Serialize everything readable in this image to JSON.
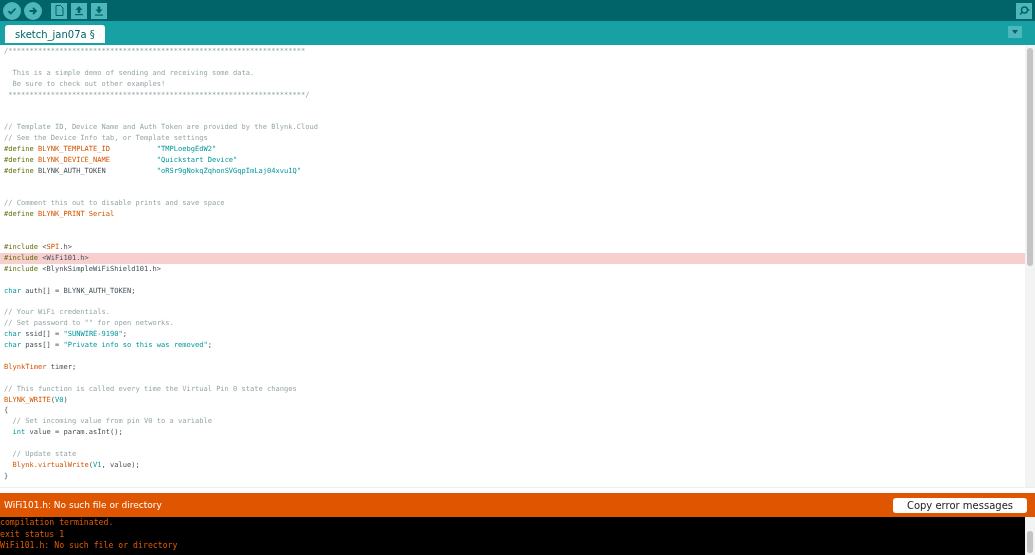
{
  "toolbar": {
    "buttons": [
      {
        "kind": "verify"
      },
      {
        "kind": "upload"
      },
      {
        "kind": "new"
      },
      {
        "kind": "open"
      },
      {
        "kind": "save"
      }
    ],
    "right_button": {
      "kind": "serial"
    }
  },
  "tabs": [
    {
      "label": "sketch_jan07a §",
      "selected": true
    }
  ],
  "editor": {
    "lines": [
      {
        "highlighted": false,
        "tokens": [
          {
            "kind": "comment",
            "text": "/**********************************************************************"
          }
        ]
      },
      {
        "highlighted": false
      },
      {
        "highlighted": false,
        "tokens": [
          {
            "kind": "comment",
            "text": "  This is a simple demo of sending and receiving some data."
          }
        ]
      },
      {
        "highlighted": false,
        "tokens": [
          {
            "kind": "comment",
            "text": "  Be sure to check out other examples!"
          }
        ]
      },
      {
        "highlighted": false,
        "tokens": [
          {
            "kind": "comment",
            "text": " **********************************************************************/"
          }
        ]
      },
      {
        "highlighted": false
      },
      {
        "highlighted": false
      },
      {
        "highlighted": false,
        "tokens": [
          {
            "kind": "comment",
            "text": "// Template ID, Device Name and Auth Token are provided by the Blynk.Cloud"
          }
        ]
      },
      {
        "highlighted": false,
        "tokens": [
          {
            "kind": "comment",
            "text": "// See the Device Info tab, or Template settings"
          }
        ]
      },
      {
        "highlighted": false,
        "tokens": [
          {
            "kind": "directive",
            "text": "#define "
          },
          {
            "kind": "constant",
            "text": "BLYNK_TEMPLATE_ID           "
          },
          {
            "kind": "string",
            "text": "\"TMPLoebgEdW2\""
          }
        ]
      },
      {
        "highlighted": false,
        "tokens": [
          {
            "kind": "directive",
            "text": "#define "
          },
          {
            "kind": "constant",
            "text": "BLYNK_DEVICE_NAME           "
          },
          {
            "kind": "string",
            "text": "\"Quickstart Device\""
          }
        ]
      },
      {
        "highlighted": false,
        "tokens": [
          {
            "kind": "directive",
            "text": "#define "
          },
          {
            "kind": "plain",
            "text": "BLYNK_AUTH_TOKEN            "
          },
          {
            "kind": "string",
            "text": "\"oRSr9gNokqZqhonSVGqpImLaj04xvu1Q\""
          }
        ]
      },
      {
        "highlighted": false
      },
      {
        "highlighted": false
      },
      {
        "highlighted": false,
        "tokens": [
          {
            "kind": "comment",
            "text": "// Comment this out to disable prints and save space"
          }
        ]
      },
      {
        "highlighted": false,
        "tokens": [
          {
            "kind": "directive",
            "text": "#define "
          },
          {
            "kind": "constant",
            "text": "BLYNK_PRINT Serial"
          }
        ]
      },
      {
        "highlighted": false
      },
      {
        "highlighted": false
      },
      {
        "highlighted": false,
        "tokens": [
          {
            "kind": "directive",
            "text": "#include "
          },
          {
            "kind": "plain",
            "text": "<"
          },
          {
            "kind": "constant",
            "text": "SPI"
          },
          {
            "kind": "plain",
            "text": ".h>"
          }
        ]
      },
      {
        "highlighted": true,
        "tokens": [
          {
            "kind": "directive",
            "text": "#include "
          },
          {
            "kind": "plain",
            "text": "<WiFi101.h>"
          }
        ]
      },
      {
        "highlighted": false,
        "tokens": [
          {
            "kind": "directive",
            "text": "#include "
          },
          {
            "kind": "plain",
            "text": "<BlynkSimpleWiFiShield101.h>"
          }
        ]
      },
      {
        "highlighted": false
      },
      {
        "highlighted": false,
        "tokens": [
          {
            "kind": "type",
            "text": "char"
          },
          {
            "kind": "plain",
            "text": " auth[] = BLYNK_AUTH_TOKEN;"
          }
        ]
      },
      {
        "highlighted": false
      },
      {
        "highlighted": false,
        "tokens": [
          {
            "kind": "comment",
            "text": "// Your WiFi credentials."
          }
        ]
      },
      {
        "highlighted": false,
        "tokens": [
          {
            "kind": "comment",
            "text": "// Set password to \"\" for open networks."
          }
        ]
      },
      {
        "highlighted": false,
        "tokens": [
          {
            "kind": "type",
            "text": "char"
          },
          {
            "kind": "plain",
            "text": " ssid[] = "
          },
          {
            "kind": "string",
            "text": "\"SUNWIRE-9190\""
          },
          {
            "kind": "plain",
            "text": ";"
          }
        ]
      },
      {
        "highlighted": false,
        "tokens": [
          {
            "kind": "type",
            "text": "char"
          },
          {
            "kind": "plain",
            "text": " pass[] = "
          },
          {
            "kind": "string",
            "text": "\"Private info so this was removed\""
          },
          {
            "kind": "plain",
            "text": ";"
          }
        ]
      },
      {
        "highlighted": false
      },
      {
        "highlighted": false,
        "tokens": [
          {
            "kind": "constant",
            "text": "BlynkTimer"
          },
          {
            "kind": "plain",
            "text": " timer;"
          }
        ]
      },
      {
        "highlighted": false
      },
      {
        "highlighted": false,
        "tokens": [
          {
            "kind": "comment",
            "text": "// This function is called every time the Virtual Pin 0 state changes"
          }
        ]
      },
      {
        "highlighted": false,
        "tokens": [
          {
            "kind": "constant",
            "text": "BLYNK_WRITE"
          },
          {
            "kind": "plain",
            "text": "("
          },
          {
            "kind": "type",
            "text": "V0"
          },
          {
            "kind": "plain",
            "text": ")"
          }
        ]
      },
      {
        "highlighted": false,
        "tokens": [
          {
            "kind": "plain",
            "text": "{"
          }
        ]
      },
      {
        "highlighted": false,
        "tokens": [
          {
            "kind": "comment",
            "text": "  // Set incoming value from pin V0 to a variable"
          }
        ]
      },
      {
        "highlighted": false,
        "tokens": [
          {
            "kind": "type",
            "text": "  int"
          },
          {
            "kind": "plain",
            "text": " value = param.asInt();"
          }
        ]
      },
      {
        "highlighted": false
      },
      {
        "highlighted": false,
        "tokens": [
          {
            "kind": "comment",
            "text": "  // Update state"
          }
        ]
      },
      {
        "highlighted": false,
        "tokens": [
          {
            "kind": "constant",
            "text": "  Blynk.virtualWrite"
          },
          {
            "kind": "plain",
            "text": "("
          },
          {
            "kind": "type",
            "text": "V1"
          },
          {
            "kind": "plain",
            "text": ", value);"
          }
        ]
      },
      {
        "highlighted": false,
        "tokens": [
          {
            "kind": "plain",
            "text": "}"
          }
        ]
      }
    ]
  },
  "error_bar": {
    "message": "WiFi101.h: No such file or directory",
    "button": "Copy error messages"
  },
  "console": {
    "lines": [
      "compilation terminated.",
      "exit status 1",
      "WiFi101.h: No such file or directory"
    ]
  }
}
